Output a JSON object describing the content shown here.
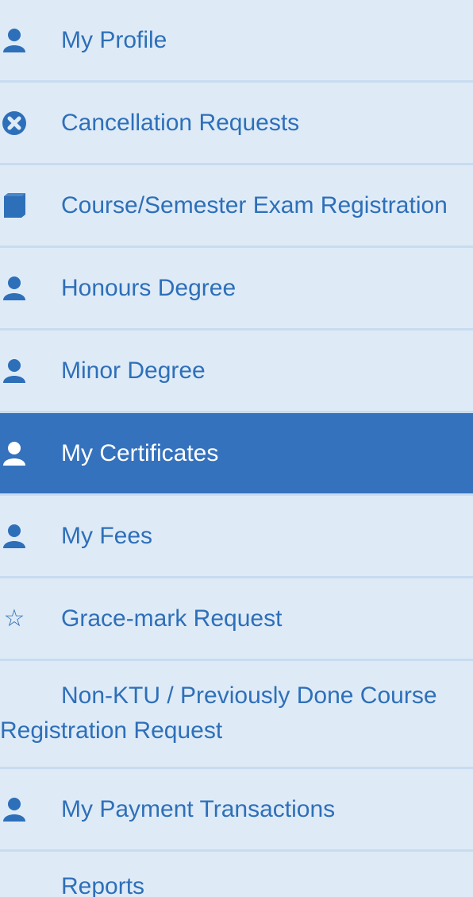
{
  "menu": {
    "items": [
      {
        "label": "My Profile",
        "icon": "user-icon"
      },
      {
        "label": "Cancellation Requests",
        "icon": "cancel-circle-icon"
      },
      {
        "label": "Course/Semester Exam Registration",
        "icon": "book-icon"
      },
      {
        "label": "Honours Degree",
        "icon": "user-icon"
      },
      {
        "label": "Minor Degree",
        "icon": "user-icon"
      },
      {
        "label": "My Certificates",
        "icon": "user-icon",
        "active": true
      },
      {
        "label": "My Fees",
        "icon": "user-icon"
      },
      {
        "label": "Grace-mark Request",
        "icon": "star-icon",
        "glyph": "☆"
      },
      {
        "label": "Non-KTU / Previously Done Course Registration Request",
        "icon": ""
      },
      {
        "label": "My Payment Transactions",
        "icon": "user-icon"
      },
      {
        "label": "Reports",
        "icon": ""
      }
    ]
  },
  "colors": {
    "background": "#deebf7",
    "link": "#2e6fb9",
    "active_background": "#3572bd",
    "active_text": "#ffffff",
    "divider": "#c8dcf0"
  }
}
